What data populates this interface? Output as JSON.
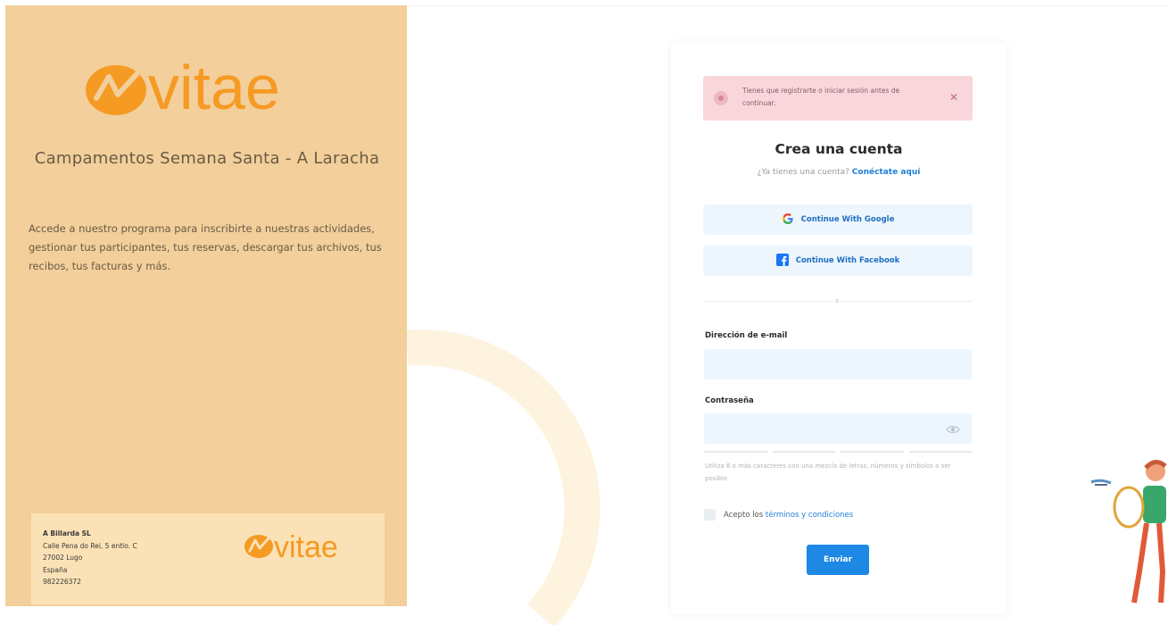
{
  "brand": {
    "logo_text": "vitae",
    "title": "Campamentos Semana Santa - A Laracha",
    "description": "Accede a nuestro programa para inscribirte a nuestras actividades, gestionar tus participantes, tus reservas, descargar tus archivos, tus recibos, tus facturas y más."
  },
  "footer": {
    "company": "A Billarda SL",
    "address_line1": "Calle Pena do Rei, 5 entlo. C",
    "address_line2": "27002 Lugo",
    "country": "España",
    "phone": "982226372"
  },
  "alert": {
    "message": "Tienes que registrarte o iniciar sesión antes de continuar."
  },
  "form": {
    "title": "Crea una cuenta",
    "have_account": "¿Ya tienes una cuenta?",
    "login_link": "Conéctate aquí",
    "google_label": "Continue With Google",
    "facebook_label": "Continue With Facebook",
    "divider": "o",
    "email_label": "Dirección de e-mail",
    "email_value": "",
    "password_label": "Contraseña",
    "password_value": "",
    "password_hint": "Utiliza 8 o más caracteres con una mezcla de letras, números y símbolos o ser posible.",
    "terms_prefix": "Acepto los",
    "terms_link": "términos y condiciones",
    "submit_label": "Enviar"
  },
  "colors": {
    "left_panel": "#f2cf9b",
    "brand_orange": "#f59a23",
    "primary_blue": "#1e88e5",
    "alert_bg": "#f9d6dc"
  },
  "icons": [
    "vitae-logo",
    "alert-icon",
    "close-icon",
    "google-icon",
    "facebook-icon",
    "eye-icon",
    "checkbox"
  ]
}
